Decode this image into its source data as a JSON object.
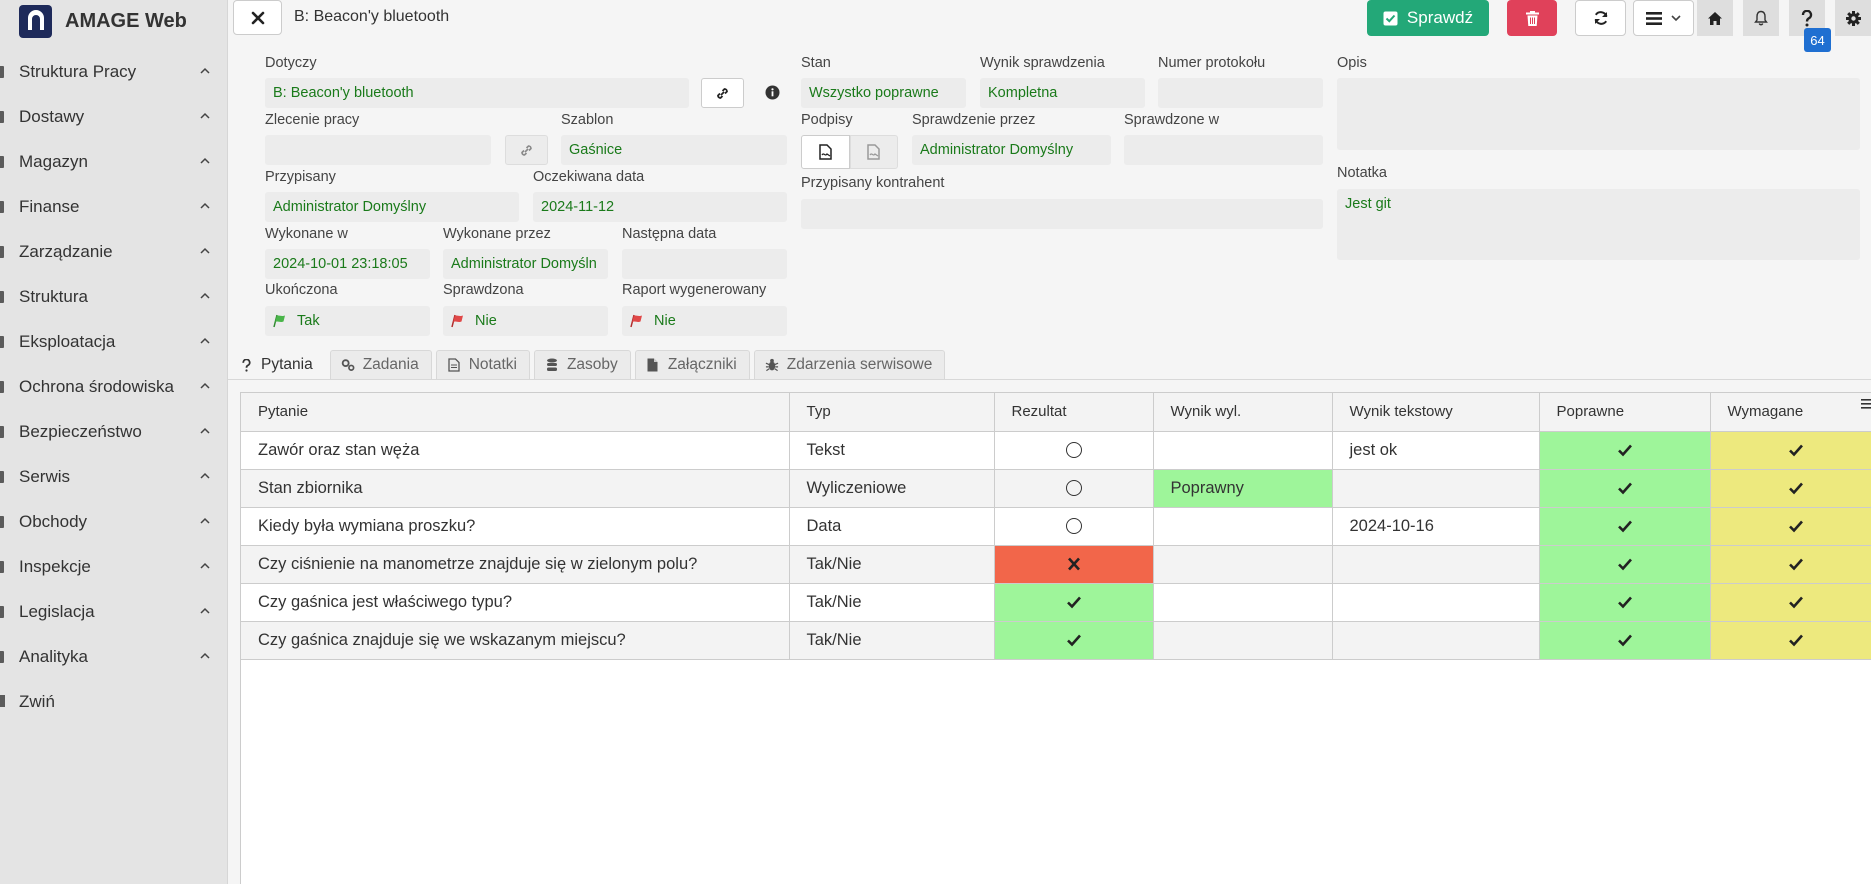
{
  "app": {
    "title": "AMAGE Web"
  },
  "sidebar": {
    "items": [
      {
        "label": "Struktura Pracy"
      },
      {
        "label": "Dostawy"
      },
      {
        "label": "Magazyn"
      },
      {
        "label": "Finanse"
      },
      {
        "label": "Zarządzanie"
      },
      {
        "label": "Struktura"
      },
      {
        "label": "Eksploatacja"
      },
      {
        "label": "Ochrona środowiska"
      },
      {
        "label": "Bezpieczeństwo"
      },
      {
        "label": "Serwis"
      },
      {
        "label": "Obchody"
      },
      {
        "label": "Inspekcje"
      },
      {
        "label": "Legislacja"
      },
      {
        "label": "Analityka"
      }
    ],
    "collapse_label": "Zwiń"
  },
  "toolbar": {
    "title": "B: Beacon'y bluetooth",
    "check_label": "Sprawdź",
    "badge_count": "64"
  },
  "form": {
    "dotyczy": {
      "label": "Dotyczy",
      "value": "B: Beacon'y bluetooth"
    },
    "zlecenie": {
      "label": "Zlecenie pracy",
      "value": ""
    },
    "szablon": {
      "label": "Szablon",
      "value": "Gaśnice"
    },
    "przypisany": {
      "label": "Przypisany",
      "value": "Administrator Domyślny"
    },
    "oczekiwana": {
      "label": "Oczekiwana data",
      "value": "2024-11-12"
    },
    "wykonane_w": {
      "label": "Wykonane w",
      "value": "2024-10-01 23:18:05"
    },
    "wykonane_przez": {
      "label": "Wykonane przez",
      "value": "Administrator Domyśln"
    },
    "nastepna": {
      "label": "Następna data",
      "value": ""
    },
    "ukonczona": {
      "label": "Ukończona",
      "value": "Tak"
    },
    "sprawdzona": {
      "label": "Sprawdzona",
      "value": "Nie"
    },
    "raport": {
      "label": "Raport wygenerowany",
      "value": "Nie"
    },
    "stan": {
      "label": "Stan",
      "value": "Wszystko poprawne"
    },
    "wynik": {
      "label": "Wynik sprawdzenia",
      "value": "Kompletna"
    },
    "numer": {
      "label": "Numer protokołu",
      "value": ""
    },
    "podpisy": {
      "label": "Podpisy"
    },
    "sprawdzenie_przez": {
      "label": "Sprawdzenie przez",
      "value": "Administrator Domyślny"
    },
    "sprawdzone_w": {
      "label": "Sprawdzone w",
      "value": ""
    },
    "kontrahent": {
      "label": "Przypisany kontrahent",
      "value": ""
    },
    "opis": {
      "label": "Opis",
      "value": ""
    },
    "notatka": {
      "label": "Notatka",
      "value": "Jest git"
    }
  },
  "tabs": [
    {
      "label": "Pytania"
    },
    {
      "label": "Zadania"
    },
    {
      "label": "Notatki"
    },
    {
      "label": "Zasoby"
    },
    {
      "label": "Załączniki"
    },
    {
      "label": "Zdarzenia serwisowe"
    }
  ],
  "table": {
    "columns": [
      "Pytanie",
      "Typ",
      "Rezultat",
      "Wynik wyl.",
      "Wynik tekstowy",
      "Poprawne",
      "Wymagane"
    ],
    "rows": [
      {
        "pytanie": "Zawór oraz stan węża",
        "typ": "Tekst",
        "rezultat": "circle",
        "wynik_wyl": "",
        "wynik_tekst": "jest ok"
      },
      {
        "pytanie": "Stan zbiornika",
        "typ": "Wyliczeniowe",
        "rezultat": "circle",
        "wynik_wyl": "Poprawny",
        "wynik_tekst": ""
      },
      {
        "pytanie": "Kiedy była wymiana proszku?",
        "typ": "Data",
        "rezultat": "circle",
        "wynik_wyl": "",
        "wynik_tekst": "2024-10-16"
      },
      {
        "pytanie": "Czy ciśnienie na manometrze znajduje się w zielonym polu?",
        "typ": "Tak/Nie",
        "rezultat": "cross",
        "wynik_wyl": "",
        "wynik_tekst": ""
      },
      {
        "pytanie": "Czy gaśnica jest właściwego typu?",
        "typ": "Tak/Nie",
        "rezultat": "check",
        "wynik_wyl": "",
        "wynik_tekst": ""
      },
      {
        "pytanie": "Czy gaśnica znajduje się we wskazanym miejscu?",
        "typ": "Tak/Nie",
        "rezultat": "check",
        "wynik_wyl": "",
        "wynik_tekst": ""
      }
    ]
  },
  "colors": {
    "brand": "#1e2a5a",
    "primary": "#23a878",
    "danger": "#e0415a",
    "badge": "#1f6fd1",
    "value_text": "#1a7a1a",
    "cell_green": "#9ef59a",
    "cell_yellow": "#ede97e",
    "cell_red": "#f2664a"
  }
}
